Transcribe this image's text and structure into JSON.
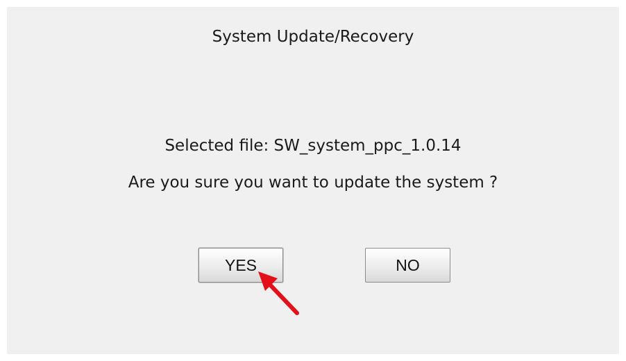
{
  "dialog": {
    "title": "System Update/Recovery",
    "selected_file": "Selected file: SW_system_ppc_1.0.14",
    "question": "Are you sure you want to update the system ?",
    "yes_label": "YES",
    "no_label": "NO"
  },
  "annotation": {
    "icon": "red-arrow-icon",
    "color": "#e3101b"
  }
}
